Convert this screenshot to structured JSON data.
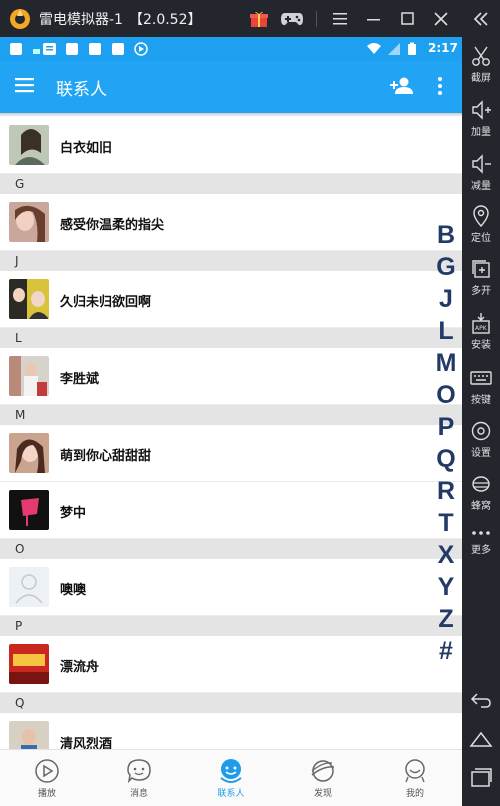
{
  "emulator": {
    "title": "雷电模拟器-1",
    "version": "【2.0.52】",
    "sidebar": [
      {
        "label": "截屏",
        "icon": "scissors-icon"
      },
      {
        "label": "加量",
        "icon": "volume-up-icon"
      },
      {
        "label": "减量",
        "icon": "volume-down-icon"
      },
      {
        "label": "定位",
        "icon": "location-icon"
      },
      {
        "label": "多开",
        "icon": "multi-instance-icon"
      },
      {
        "label": "安装",
        "icon": "install-apk-icon"
      },
      {
        "label": "按键",
        "icon": "keyboard-icon"
      },
      {
        "label": "设置",
        "icon": "settings-icon"
      },
      {
        "label": "蜂窝",
        "icon": "hive-icon"
      },
      {
        "label": "更多",
        "icon": "more-icon"
      }
    ]
  },
  "status_bar": {
    "time": "2:17"
  },
  "app_bar": {
    "title": "联系人"
  },
  "contacts": {
    "rows": [
      {
        "name": "白衣如旧"
      },
      {
        "section": "G"
      },
      {
        "name": "感受你温柔的指尖"
      },
      {
        "section": "J"
      },
      {
        "name": "久归未归欲回啊"
      },
      {
        "section": "L"
      },
      {
        "name": "李胜斌 "
      },
      {
        "section": "M"
      },
      {
        "name": "萌到你心甜甜甜"
      },
      {
        "name": "梦中"
      },
      {
        "section": "O"
      },
      {
        "name": "噢噢"
      },
      {
        "section": "P"
      },
      {
        "name": "漂流舟"
      },
      {
        "section": "Q"
      },
      {
        "name": "清风烈酒"
      }
    ],
    "index_letters": [
      "B",
      "G",
      "J",
      "L",
      "M",
      "O",
      "P",
      "Q",
      "R",
      "T",
      "X",
      "Y",
      "Z",
      "#"
    ]
  },
  "bottom_nav": [
    {
      "label": "播放",
      "icon": "play-icon"
    },
    {
      "label": "消息",
      "icon": "message-icon"
    },
    {
      "label": "联系人",
      "icon": "contacts-icon",
      "active": true
    },
    {
      "label": "发现",
      "icon": "discover-icon"
    },
    {
      "label": "我的",
      "icon": "profile-icon"
    }
  ],
  "colors": {
    "accent": "#21a4f3",
    "index_letter": "#233a66",
    "active_nav": "#1e9be9"
  }
}
